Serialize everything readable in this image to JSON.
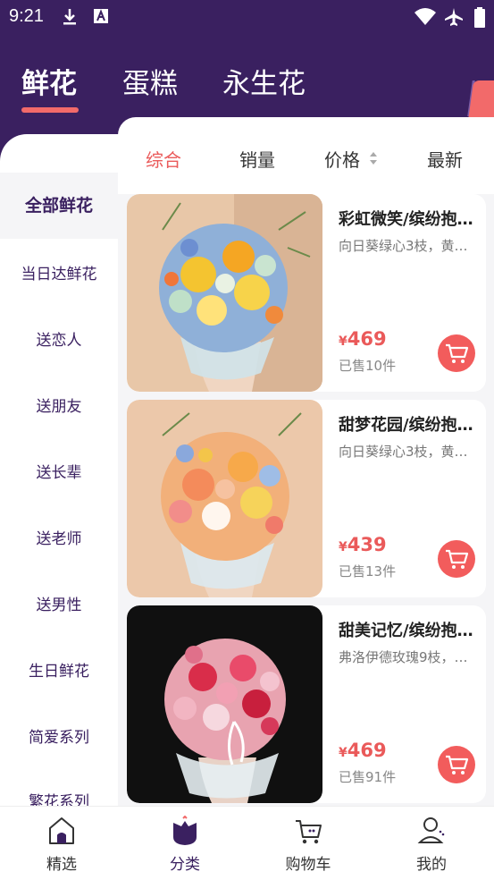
{
  "status": {
    "time": "9:21"
  },
  "top_tabs": [
    "鲜花",
    "蛋糕",
    "永生花"
  ],
  "sidebar": {
    "items": [
      "全部鲜花",
      "当日达鲜花",
      "送恋人",
      "送朋友",
      "送长辈",
      "送老师",
      "送男性",
      "生日鲜花",
      "简爱系列",
      "繁花系列"
    ]
  },
  "sort": {
    "items": [
      "综合",
      "销量",
      "价格",
      "最新"
    ]
  },
  "products": [
    {
      "title": "彩虹微笑/缤纷抱…",
      "desc": "向日葵绿心3枝，黄…",
      "currency": "¥",
      "price": "469",
      "sold": "已售10件"
    },
    {
      "title": "甜梦花园/缤纷抱…",
      "desc": "向日葵绿心3枝，黄…",
      "currency": "¥",
      "price": "439",
      "sold": "已售13件"
    },
    {
      "title": "甜美记忆/缤纷抱…",
      "desc": "弗洛伊德玫瑰9枝，…",
      "currency": "¥",
      "price": "469",
      "sold": "已售91件"
    }
  ],
  "bottom_nav": {
    "items": [
      "精选",
      "分类",
      "购物车",
      "我的"
    ]
  },
  "colors": {
    "brand": "#3a2060",
    "accent": "#f26a6a",
    "price": "#ea5a5a"
  },
  "icons": {
    "status": [
      "download-icon",
      "text-icon",
      "wifi-icon",
      "airplane-icon",
      "battery-icon"
    ],
    "nav": [
      "home-icon",
      "category-icon",
      "cart-icon",
      "user-icon"
    ],
    "sort_price": "sort-arrows-icon",
    "cart_button": "cart-icon"
  }
}
